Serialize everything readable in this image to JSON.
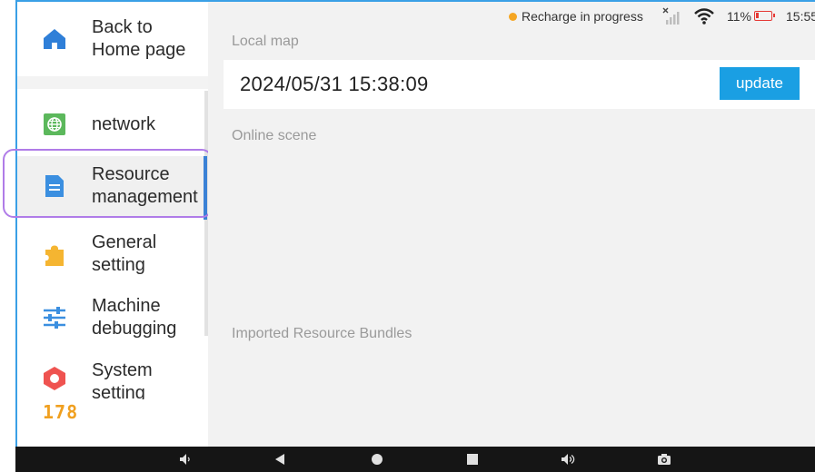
{
  "sidebar": {
    "back_label": "Back to\nHome page",
    "items": [
      {
        "label": "network",
        "icon": "globe-icon",
        "color": "#5cb85c"
      },
      {
        "label": "Resource\nmanagement",
        "icon": "document-icon",
        "color": "#3b8fe0",
        "active": true
      },
      {
        "label": "General\nsetting",
        "icon": "puzzle-icon",
        "color": "#f5b531"
      },
      {
        "label": "Machine\ndebugging",
        "icon": "sliders-icon",
        "color": "#3b8fe0"
      },
      {
        "label": "System\nsetting",
        "icon": "hexagon-icon",
        "color": "#ef5350"
      }
    ],
    "counter": "178"
  },
  "status": {
    "recharge_text": "Recharge in progress",
    "battery_percent": "11%",
    "time": "15:55"
  },
  "main": {
    "local_map_label": "Local map",
    "map_timestamp": "2024/05/31 15:38:09",
    "update_label": "update",
    "online_scene_label": "Online scene",
    "imported_label": "Imported Resource Bundles"
  },
  "colors": {
    "accent": "#1a9fe3",
    "active_bar": "#3b82d6",
    "highlight": "#b07ce8",
    "status_dot": "#f5a623",
    "battery": "#e53935"
  }
}
